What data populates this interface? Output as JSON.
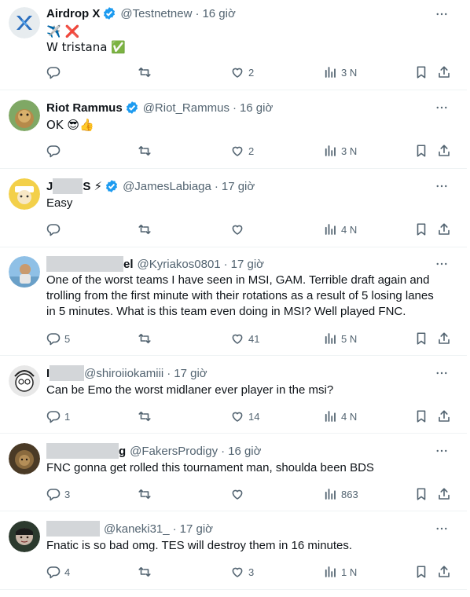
{
  "tweets": [
    {
      "name": "Airdrop X",
      "handle": "@Testnetnew",
      "time": "16 giờ",
      "body_lines": [
        "✈️ ❌",
        "W tristana ✅"
      ],
      "reply_count": "",
      "retweet_count": "",
      "like_count": "2",
      "views": "3 N"
    },
    {
      "name": "Riot Rammus",
      "handle": "@Riot_Rammus",
      "time": "16 giờ",
      "body_lines": [
        "OK 😎👍"
      ],
      "reply_count": "",
      "retweet_count": "",
      "like_count": "2",
      "views": "3 N"
    },
    {
      "name_suffix": "S ⚡",
      "name_prefix": "J",
      "handle": "@JamesLabiaga",
      "time": "17 giờ",
      "body_lines": [
        "Easy"
      ],
      "reply_count": "",
      "retweet_count": "",
      "like_count": "",
      "views": "4 N"
    },
    {
      "name_suffix": "el",
      "handle": "@Kyriakos0801",
      "time": "17 giờ",
      "body_lines": [
        "One of the worst teams I have seen in MSI, GAM. Terrible draft again and",
        "trolling from the first minute with their rotations as a result of 5 losing lanes",
        "in 5 minutes. What is this team even doing in MSI? Well played FNC."
      ],
      "reply_count": "5",
      "retweet_count": "",
      "like_count": "41",
      "views": "5 N"
    },
    {
      "name_prefix": "I",
      "handle": "@shiroiiokamiii",
      "time": "17 giờ",
      "body_lines": [
        "Can be Emo the worst midlaner ever player in the msi?"
      ],
      "reply_count": "1",
      "retweet_count": "",
      "like_count": "14",
      "views": "4 N"
    },
    {
      "name_suffix": "g",
      "handle": "@FakersProdigy",
      "time": "16 giờ",
      "body_lines": [
        "FNC gonna get rolled this tournament man, shoulda been BDS"
      ],
      "reply_count": "3",
      "retweet_count": "",
      "like_count": "",
      "views": "863"
    },
    {
      "handle": "@kaneki31_",
      "time": "17 giờ",
      "body_lines": [
        "Fnatic is so bad omg. TES will destroy them in 16 minutes."
      ],
      "reply_count": "4",
      "retweet_count": "",
      "like_count": "3",
      "views": "1 N"
    }
  ],
  "colors": {
    "verified": "#1d9bf0",
    "muted": "#536471",
    "text": "#0f1419",
    "divider": "#eff3f4",
    "redaction": "#d3d6d9"
  },
  "icons": [
    "reply-icon",
    "retweet-icon",
    "like-icon",
    "views-icon",
    "bookmark-icon",
    "share-icon",
    "more-icon",
    "verified-icon"
  ]
}
